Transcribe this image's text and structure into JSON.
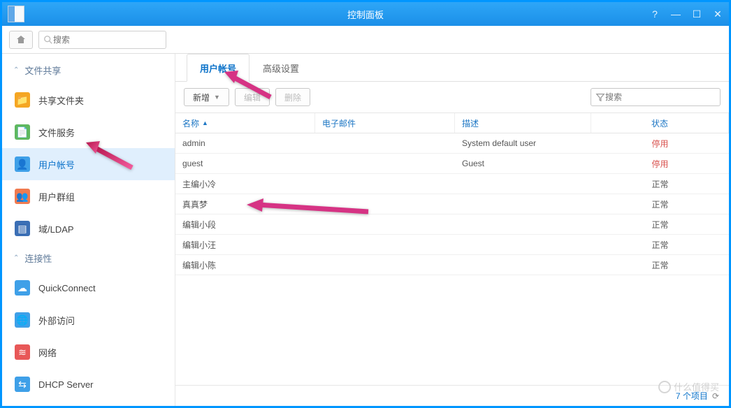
{
  "title": "控制面板",
  "search": {
    "placeholder": "搜索"
  },
  "sidebar": {
    "sections": [
      {
        "label": "文件共享",
        "items": [
          {
            "label": "共享文件夹",
            "color": "#f5a623"
          },
          {
            "label": "文件服务",
            "color": "#5fb85f"
          },
          {
            "label": "用户帐号",
            "color": "#3fa0e8",
            "active": true
          },
          {
            "label": "用户群组",
            "color": "#f07b50"
          },
          {
            "label": "域/LDAP",
            "color": "#3b6fb5"
          }
        ]
      },
      {
        "label": "连接性",
        "items": [
          {
            "label": "QuickConnect",
            "color": "#3fa0e8"
          },
          {
            "label": "外部访问",
            "color": "#3fa0e8"
          },
          {
            "label": "网络",
            "color": "#e85858"
          },
          {
            "label": "DHCP Server",
            "color": "#3fa0e8"
          }
        ]
      }
    ]
  },
  "tabs": [
    {
      "label": "用户帐号",
      "active": true
    },
    {
      "label": "高级设置",
      "active": false
    }
  ],
  "actions": {
    "create": "新增",
    "edit": "编辑",
    "delete": "删除",
    "filter_placeholder": "搜索"
  },
  "columns": {
    "name": "名称",
    "email": "电子邮件",
    "desc": "描述",
    "status": "状态"
  },
  "status_labels": {
    "normal": "正常",
    "disabled": "停用"
  },
  "users": [
    {
      "name": "admin",
      "email": "",
      "desc": "System default user",
      "status": "disabled"
    },
    {
      "name": "guest",
      "email": "",
      "desc": "Guest",
      "status": "disabled"
    },
    {
      "name": "主编小冷",
      "email": "",
      "desc": "",
      "status": "normal"
    },
    {
      "name": "真真梦",
      "email": "",
      "desc": "",
      "status": "normal"
    },
    {
      "name": "编辑小段",
      "email": "",
      "desc": "",
      "status": "normal"
    },
    {
      "name": "编辑小汪",
      "email": "",
      "desc": "",
      "status": "normal"
    },
    {
      "name": "编辑小陈",
      "email": "",
      "desc": "",
      "status": "normal"
    }
  ],
  "footer": {
    "count_text": "7 个项目",
    "refresh_icon": "⟳"
  },
  "watermark": "什么值得买"
}
